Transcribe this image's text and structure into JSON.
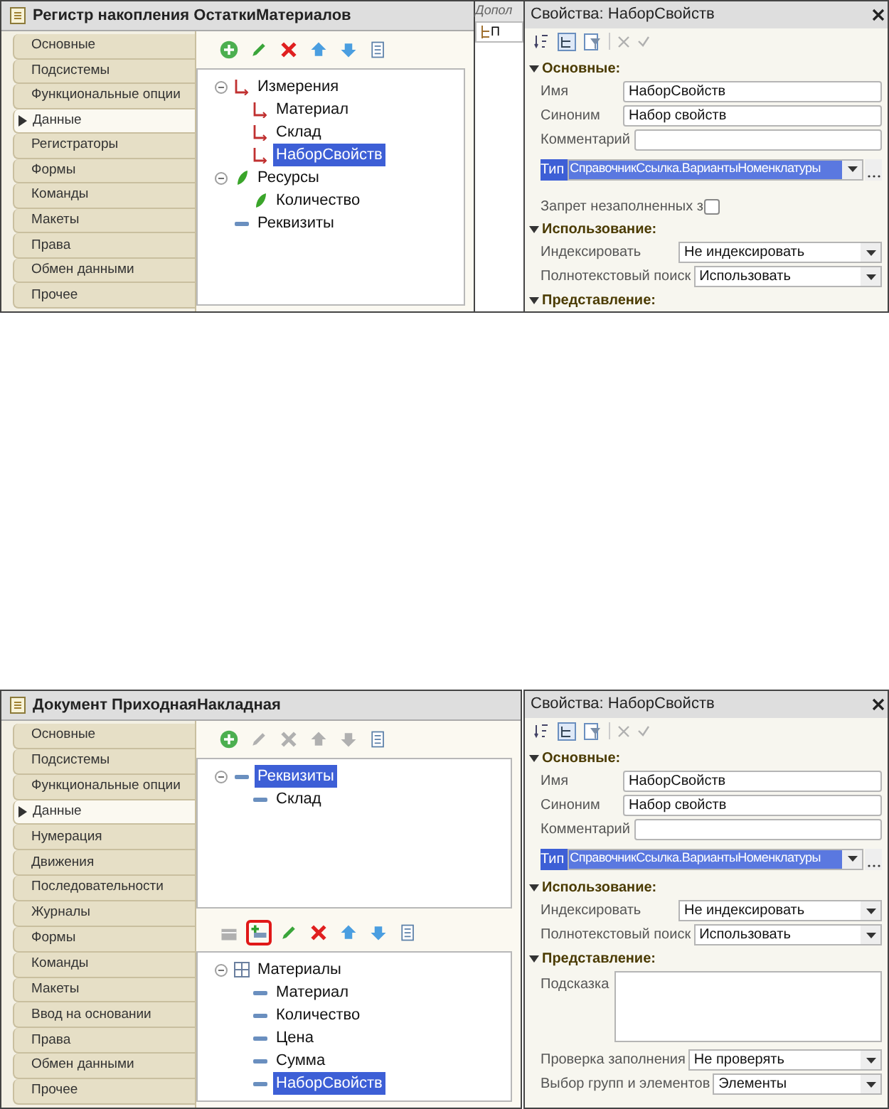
{
  "screens": [
    {
      "editor": {
        "title": "Регистр накопления ОстаткиМатериалов",
        "tabs": [
          {
            "label": "Основные",
            "selected": false
          },
          {
            "label": "Подсистемы",
            "selected": false
          },
          {
            "label": "Функциональные опции",
            "selected": false
          },
          {
            "label": "Данные",
            "selected": true
          },
          {
            "label": "Регистраторы",
            "selected": false
          },
          {
            "label": "Формы",
            "selected": false
          },
          {
            "label": "Команды",
            "selected": false
          },
          {
            "label": "Макеты",
            "selected": false
          },
          {
            "label": "Права",
            "selected": false
          },
          {
            "label": "Обмен данными",
            "selected": false
          },
          {
            "label": "Прочее",
            "selected": false
          }
        ],
        "sections": [
          {
            "toolbar": [
              {
                "kind": "add",
                "disabled": false,
                "highlighted": false
              },
              {
                "kind": "edit",
                "disabled": false,
                "highlighted": false
              },
              {
                "kind": "delete",
                "disabled": false,
                "highlighted": false
              },
              {
                "kind": "up",
                "disabled": false,
                "highlighted": false
              },
              {
                "kind": "down",
                "disabled": false,
                "highlighted": false
              },
              {
                "kind": "list",
                "disabled": false,
                "highlighted": false
              }
            ],
            "tree": [
              {
                "label": "Измерения",
                "kind": "dimension",
                "selected": false,
                "expanded": true,
                "children": [
                  {
                    "label": "Материал",
                    "kind": "dimension",
                    "selected": false
                  },
                  {
                    "label": "Склад",
                    "kind": "dimension",
                    "selected": false
                  },
                  {
                    "label": "НаборСвойств",
                    "kind": "dimension",
                    "selected": true
                  }
                ]
              },
              {
                "label": "Ресурсы",
                "kind": "resource",
                "selected": false,
                "expanded": true,
                "children": [
                  {
                    "label": "Количество",
                    "kind": "resource",
                    "selected": false
                  }
                ]
              },
              {
                "label": "Реквизиты",
                "kind": "attribute",
                "selected": false
              }
            ]
          }
        ]
      },
      "background_tab": {
        "title": "Допол",
        "tab": "П"
      },
      "properties": {
        "title": "Свойства: НаборСвойств",
        "rows": [
          {
            "kind": "section",
            "label": "Основные:",
            "expanded": true
          },
          {
            "kind": "field",
            "label": "Имя",
            "value": "НаборСвойств"
          },
          {
            "kind": "field",
            "label": "Синоним",
            "value": "Набор свойств"
          },
          {
            "kind": "field",
            "label": "Комментарий"
          },
          {
            "kind": "type",
            "label": "Тип",
            "value": "СправочникСсылка.ВариантыНоменклатуры",
            "selected": true
          },
          {
            "kind": "checkbox",
            "label": "Запрет незаполненных з",
            "checked": false
          },
          {
            "kind": "section",
            "label": "Использование:",
            "expanded": true
          },
          {
            "kind": "select",
            "label": "Индексировать",
            "value": "Не индексировать"
          },
          {
            "kind": "select",
            "label": "Полнотекстовый поиск",
            "value": "Использовать"
          },
          {
            "kind": "section",
            "label": "Представление:",
            "expanded": true
          }
        ]
      }
    },
    {
      "editor": {
        "title": "Документ ПриходнаяНакладная",
        "tabs": [
          {
            "label": "Основные",
            "selected": false
          },
          {
            "label": "Подсистемы",
            "selected": false
          },
          {
            "label": "Функциональные опции",
            "selected": false
          },
          {
            "label": "Данные",
            "selected": true
          },
          {
            "label": "Нумерация",
            "selected": false
          },
          {
            "label": "Движения",
            "selected": false
          },
          {
            "label": "Последовательности",
            "selected": false
          },
          {
            "label": "Журналы",
            "selected": false
          },
          {
            "label": "Формы",
            "selected": false
          },
          {
            "label": "Команды",
            "selected": false
          },
          {
            "label": "Макеты",
            "selected": false
          },
          {
            "label": "Ввод на основании",
            "selected": false
          },
          {
            "label": "Права",
            "selected": false
          },
          {
            "label": "Обмен данными",
            "selected": false
          },
          {
            "label": "Прочее",
            "selected": false
          }
        ],
        "sections": [
          {
            "toolbar": [
              {
                "kind": "add",
                "disabled": false,
                "highlighted": false
              },
              {
                "kind": "edit",
                "disabled": true,
                "highlighted": false
              },
              {
                "kind": "delete",
                "disabled": true,
                "highlighted": false
              },
              {
                "kind": "up",
                "disabled": true,
                "highlighted": false
              },
              {
                "kind": "down",
                "disabled": true,
                "highlighted": false
              },
              {
                "kind": "list",
                "disabled": false,
                "highlighted": false
              }
            ],
            "tree": [
              {
                "label": "Реквизиты",
                "kind": "attribute",
                "selected": true,
                "expanded": true,
                "children": [
                  {
                    "label": "Склад",
                    "kind": "attribute",
                    "selected": false
                  }
                ]
              }
            ]
          },
          {
            "toolbar": [
              {
                "kind": "add-table",
                "disabled": true,
                "highlighted": false
              },
              {
                "kind": "add-column",
                "disabled": false,
                "highlighted": true
              },
              {
                "kind": "edit",
                "disabled": false,
                "highlighted": false
              },
              {
                "kind": "delete",
                "disabled": false,
                "highlighted": false
              },
              {
                "kind": "up",
                "disabled": false,
                "highlighted": false
              },
              {
                "kind": "down",
                "disabled": false,
                "highlighted": false
              },
              {
                "kind": "list",
                "disabled": false,
                "highlighted": false
              }
            ],
            "tree": [
              {
                "label": "Материалы",
                "kind": "table",
                "selected": false,
                "expanded": true,
                "children": [
                  {
                    "label": "Материал",
                    "kind": "attribute",
                    "selected": false
                  },
                  {
                    "label": "Количество",
                    "kind": "attribute",
                    "selected": false
                  },
                  {
                    "label": "Цена",
                    "kind": "attribute",
                    "selected": false
                  },
                  {
                    "label": "Сумма",
                    "kind": "attribute",
                    "selected": false
                  },
                  {
                    "label": "НаборСвойств",
                    "kind": "attribute",
                    "selected": true
                  }
                ]
              }
            ]
          }
        ]
      },
      "properties": {
        "title": "Свойства: НаборСвойств",
        "rows": [
          {
            "kind": "section",
            "label": "Основные:",
            "expanded": true
          },
          {
            "kind": "field",
            "label": "Имя",
            "value": "НаборСвойств"
          },
          {
            "kind": "field",
            "label": "Синоним",
            "value": "Набор свойств"
          },
          {
            "kind": "field",
            "label": "Комментарий"
          },
          {
            "kind": "type",
            "label": "Тип",
            "value": "СправочникСсылка.ВариантыНоменклатуры",
            "selected": true
          },
          {
            "kind": "section",
            "label": "Использование:",
            "expanded": true
          },
          {
            "kind": "select",
            "label": "Индексировать",
            "value": "Не индексировать"
          },
          {
            "kind": "select",
            "label": "Полнотекстовый поиск",
            "value": "Использовать"
          },
          {
            "kind": "section",
            "label": "Представление:",
            "expanded": true
          },
          {
            "kind": "textarea",
            "label": "Подсказка"
          },
          {
            "kind": "select",
            "label": "Проверка заполнения",
            "value": "Не проверять"
          },
          {
            "kind": "select",
            "label": "Выбор групп и элементов",
            "value": "Элементы"
          }
        ]
      }
    }
  ]
}
